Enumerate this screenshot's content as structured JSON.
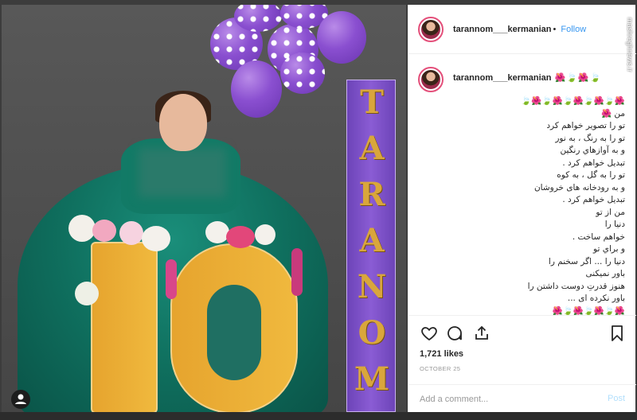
{
  "post": {
    "username": "tarannom___kermanian",
    "follow_label": "Follow",
    "caption_username": "tarannom___kermanian",
    "caption_emoji_first": "🌺🍃🌺🍃",
    "caption_lines": [
      "🌺🍃🌺🍃🌺🍃🌺🍃🌺🍃",
      "من 🌺",
      "تو را تصویر خواهم کرد",
      "تو را به رنگ ، به نور",
      "و به آوازهاي رنگين",
      "تبديل خواهم كرد .",
      "تو را به گل ، به كوه",
      "و به رودخانه هاى خروشان",
      "تبديل خواهم كرد .",
      "من از تو",
      "دنيا را",
      "خواهم ساخت .",
      "و براي تو",
      "دنيا را ... اگر سخنم را",
      "باور نميكنی",
      "هنوز قدرتِ دوست داشتن را",
      "باور نكرده اى ...",
      "🌺🍃🌺🍃🌺🍃🌺",
      "🌺🍃🌺🍃🌺🍃🌺🍃"
    ],
    "likes": "1,721 likes",
    "date": "OCTOBER 25",
    "comment_placeholder": "Add a comment...",
    "post_label": "Post"
  },
  "photo": {
    "letters": [
      "T",
      "A",
      "R",
      "A",
      "N",
      "O",
      "M"
    ],
    "number": "10"
  },
  "watermark": "mashreghnews.ir",
  "icons": {
    "like": "heart-icon",
    "comment": "comment-icon",
    "share": "share-icon",
    "save": "bookmark-icon",
    "user": "user-icon"
  }
}
